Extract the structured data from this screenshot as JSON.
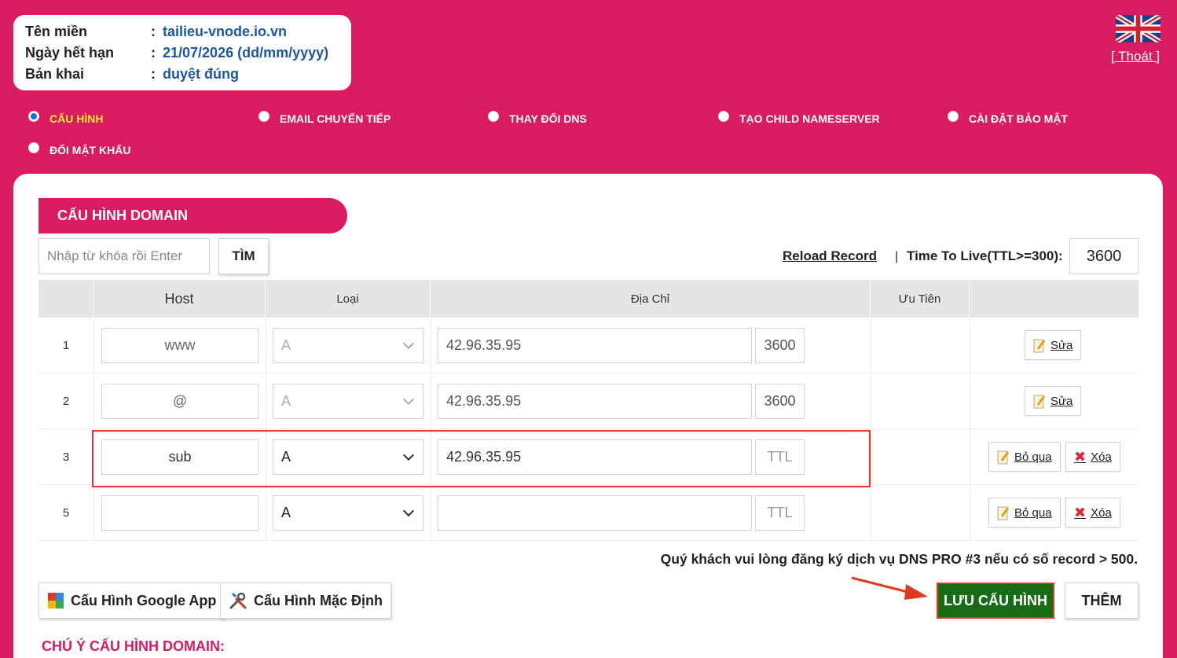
{
  "info": {
    "rows": [
      {
        "label": "Tên miền",
        "value": "tailieu-vnode.io.vn"
      },
      {
        "label": "Ngày hết hạn",
        "value": "21/07/2026 (dd/mm/yyyy)"
      },
      {
        "label": "Bản khai",
        "value": "duyệt đúng"
      }
    ],
    "colon": ":"
  },
  "header": {
    "flag_icon": "uk-flag-icon",
    "logout": "[ Thoát ]"
  },
  "tabs": [
    {
      "label": "CẤU HÌNH",
      "active": true
    },
    {
      "label": "EMAIL CHUYỂN TIẾP",
      "active": false
    },
    {
      "label": "THAY ĐỔI DNS",
      "active": false
    },
    {
      "label": "TẠO CHILD NAMESERVER",
      "active": false
    },
    {
      "label": "CÀI ĐẶT BẢO MẬT",
      "active": false
    },
    {
      "label": "ĐỔI MẬT KHẨU",
      "active": false
    }
  ],
  "panel": {
    "title": "CẤU HÌNH DOMAIN",
    "search_placeholder": "Nhập từ khóa rồi Enter",
    "search_button": "TÌM",
    "reload": "Reload Record",
    "separator": "|",
    "ttl_label": "Time To Live(TTL>=300):",
    "ttl_value": "3600"
  },
  "table": {
    "headers": [
      "Host",
      "Loại",
      "Địa Chỉ",
      "Ưu Tiên"
    ],
    "rows": [
      {
        "num": "1",
        "host": "www",
        "type": "A",
        "address": "42.96.35.95",
        "ttl": "3600",
        "ttl_placeholder": "TTL",
        "editing": false,
        "actions": [
          "Sửa"
        ]
      },
      {
        "num": "2",
        "host": "@",
        "type": "A",
        "address": "42.96.35.95",
        "ttl": "3600",
        "ttl_placeholder": "TTL",
        "editing": false,
        "actions": [
          "Sửa"
        ]
      },
      {
        "num": "3",
        "host": "sub",
        "type": "A",
        "address": "42.96.35.95",
        "ttl": "",
        "ttl_placeholder": "TTL",
        "editing": true,
        "actions": [
          "Bỏ qua",
          "Xóa"
        ]
      },
      {
        "num": "5",
        "host": "",
        "type": "A",
        "address": "",
        "ttl": "",
        "ttl_placeholder": "TTL",
        "editing": true,
        "actions": [
          "Bỏ qua",
          "Xóa"
        ]
      }
    ]
  },
  "notice": "Quý khách vui lòng đăng ký dịch vụ DNS PRO #3 nếu có số record > 500.",
  "buttons": {
    "google_app": "Cấu Hình Google App",
    "default_config": "Cấu Hình Mặc Định",
    "save": "LƯU CẤU HÌNH",
    "add": "THÊM"
  },
  "note_title": "CHÚ Ý CẤU HÌNH DOMAIN:",
  "colors": {
    "brand": "#da1b5f",
    "save_green": "#186b17",
    "highlight_red": "#e23a26",
    "link_blue": "#1d57a4"
  }
}
